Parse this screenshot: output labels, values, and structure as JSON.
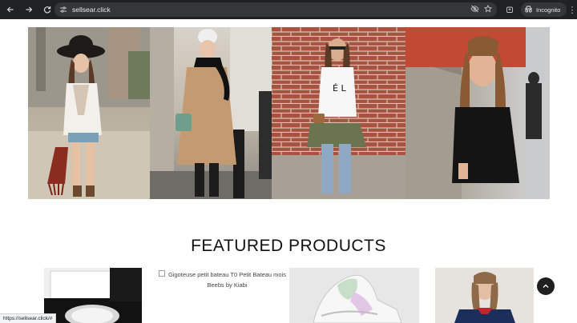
{
  "browser": {
    "url": "sellsear.click",
    "incognito_label": "Incognito",
    "status_url": "https://sellsear.click/#",
    "icons": [
      "back-arrow-icon",
      "forward-arrow-icon",
      "reload-icon",
      "site-settings-icon",
      "eye-off-icon",
      "star-icon",
      "extension-icon",
      "incognito-icon",
      "kebab-menu-icon"
    ]
  },
  "gallery": {
    "items": [
      {
        "label": "fashion-photo-boho-hat"
      },
      {
        "label": "fashion-photo-camel-coat"
      },
      {
        "label": "fashion-photo-brick-wall"
      },
      {
        "label": "fashion-photo-black-hoodie"
      }
    ]
  },
  "featured": {
    "title": "FEATURED PRODUCTS",
    "products": [
      {
        "kind": "watch"
      },
      {
        "alt": "Gigoteuse petit bateau T0 Petit Bateau mois Beebs by Kiabi"
      },
      {
        "kind": "sneaker"
      },
      {
        "kind": "girl-sweater"
      }
    ]
  },
  "colors": {
    "chrome_bg": "#202124",
    "omnibox_bg": "#35363a",
    "text_dark": "#111111",
    "scroll_button": "#1f1f1f"
  }
}
